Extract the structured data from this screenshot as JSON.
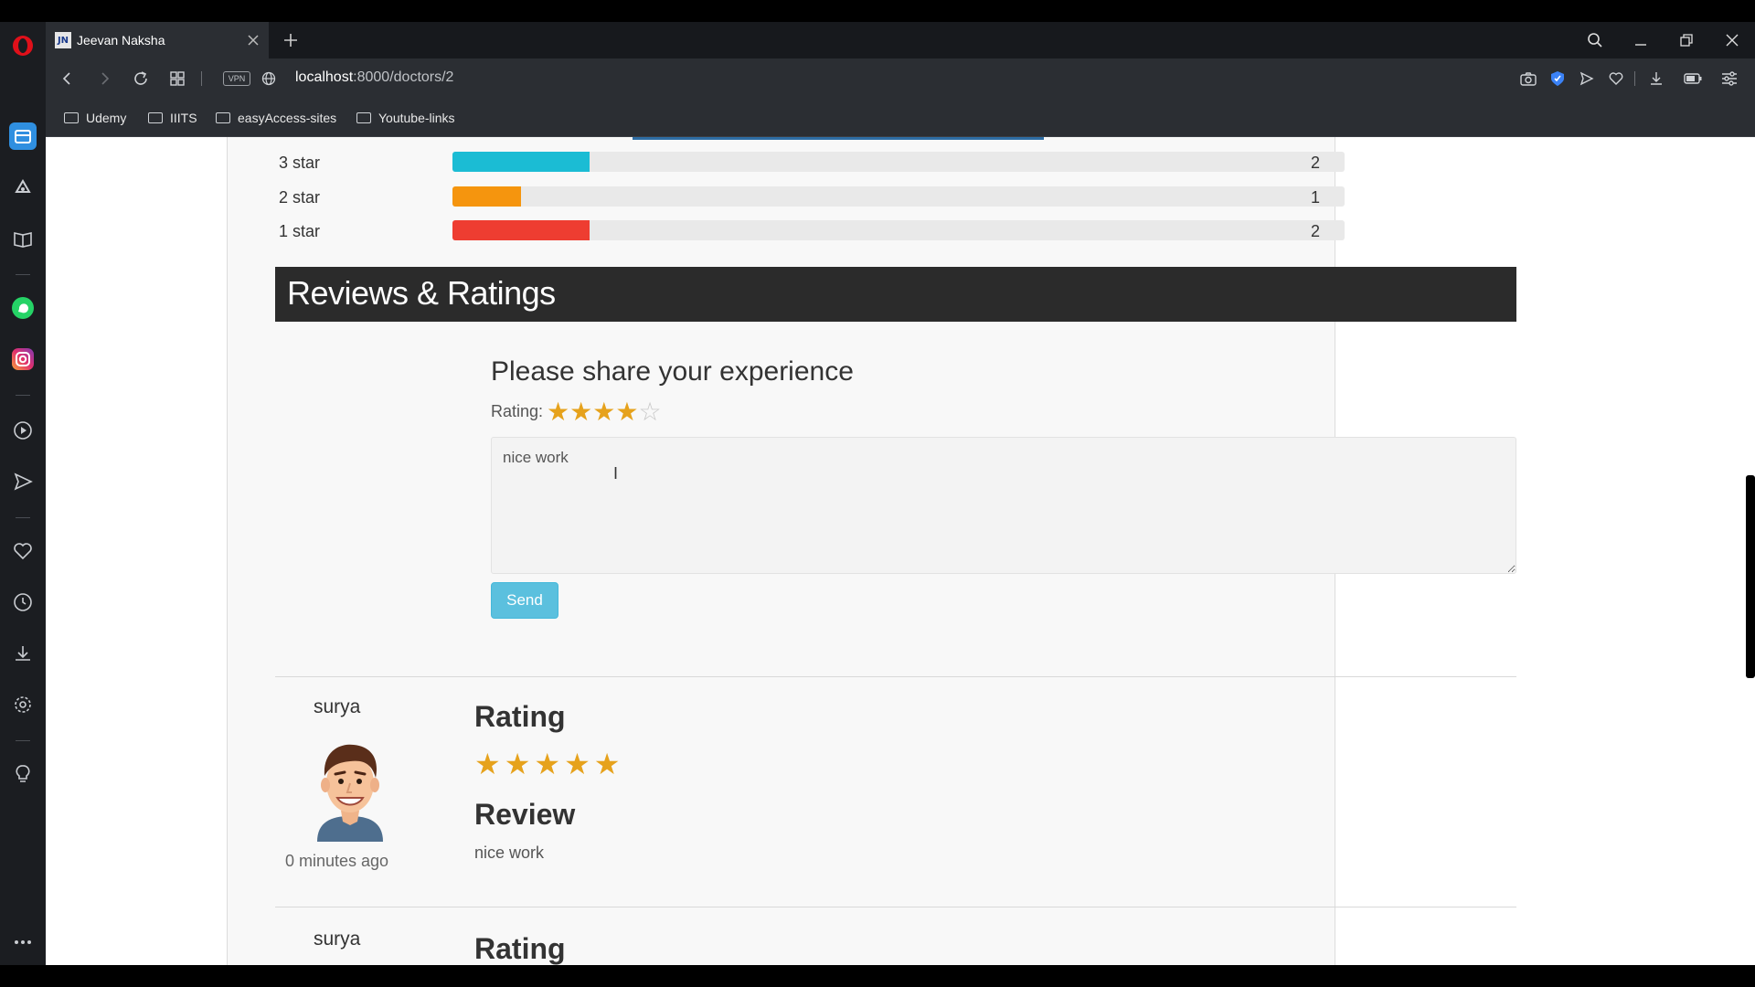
{
  "browser": {
    "tab_title": "Jeevan Naksha",
    "tab_favicon_text": "JN",
    "url_host": "localhost",
    "url_path": ":8000/doctors/2",
    "vpn_label": "VPN",
    "bookmarks": [
      "Udemy",
      "IIITS",
      "easyAccess-sites",
      "Youtube-links"
    ]
  },
  "sidebar": {
    "icons": [
      "opera-logo-icon",
      "workspaces-icon",
      "ai-icon",
      "bookmarks-icon",
      "whatsapp-icon",
      "instagram-icon",
      "player-icon",
      "send-icon",
      "heart-icon",
      "history-icon",
      "downloads-icon",
      "settings-icon",
      "tips-icon",
      "more-icon"
    ]
  },
  "breakdown": {
    "rows": [
      {
        "label": "3 star",
        "count": "2",
        "fraction": 0.154,
        "color": "#1bbcd4"
      },
      {
        "label": "2 star",
        "count": "1",
        "fraction": 0.077,
        "color": "#f5950e"
      },
      {
        "label": "1 star",
        "count": "2",
        "fraction": 0.154,
        "color": "#ee3d31"
      }
    ]
  },
  "reviews_section": {
    "title": "Reviews & Ratings",
    "share_title": "Please share your experience",
    "rating_label": "Rating:",
    "input_rating": 4,
    "input_rating_max": 5,
    "review_text": "nice work",
    "send_label": "Send"
  },
  "reviews": [
    {
      "user": "surya",
      "time": "0 minutes ago",
      "rating_heading": "Rating",
      "stars": 5,
      "review_heading": "Review",
      "text": "nice work"
    },
    {
      "user": "surya",
      "rating_heading": "Rating"
    }
  ],
  "colors": {
    "header_bg": "#2b2b2b",
    "star_color": "#e6a21c",
    "send_button": "#5bc0de"
  }
}
